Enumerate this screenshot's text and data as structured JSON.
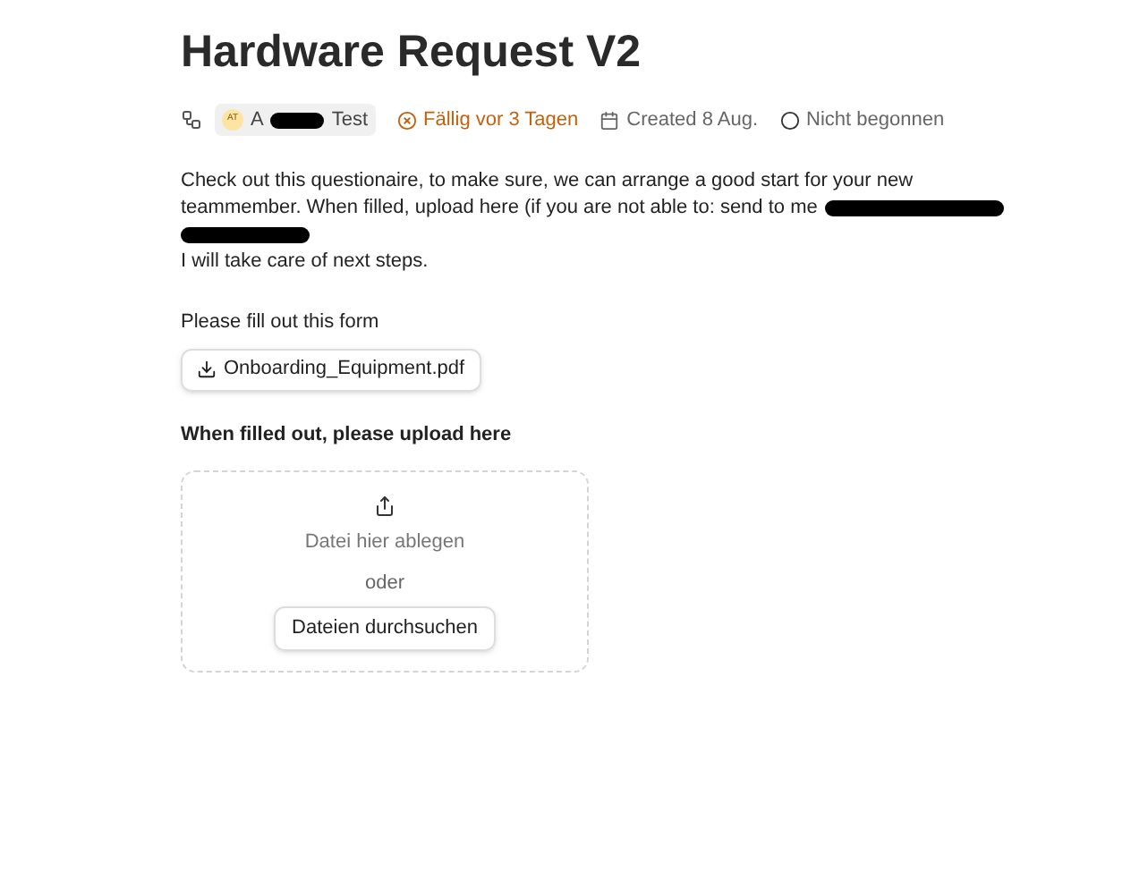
{
  "title": "Hardware Request V2",
  "meta": {
    "assignee": {
      "initials": "AT",
      "name_start": "A",
      "name_end": "Test"
    },
    "due": "Fällig vor 3 Tagen",
    "created": "Created 8 Aug.",
    "status": "Nicht begonnen"
  },
  "description": {
    "lines": [
      "Check out this questionaire, to make sure, we can arrange a good start for your new",
      "teammember. When filled, upload here (if you are not able to: send to me",
      "I will take care of next steps."
    ]
  },
  "form_label": "Please fill out this form",
  "attachment": "Onboarding_Equipment.pdf",
  "upload_heading": "When filled out, please upload here",
  "dropzone": {
    "hint": "Datei hier ablegen",
    "or": "oder",
    "button": "Dateien durchsuchen"
  }
}
